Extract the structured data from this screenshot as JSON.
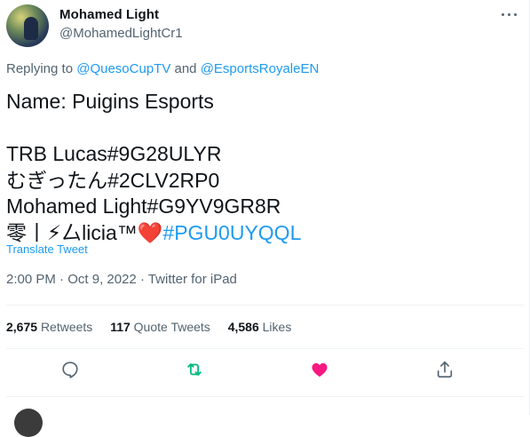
{
  "author": {
    "display_name": "Mohamed Light",
    "handle": "@MohamedLightCr1"
  },
  "reply": {
    "prefix": "Replying to ",
    "mention1": "@QuesoCupTV",
    "joiner": " and ",
    "mention2": "@EsportsRoyaleEN"
  },
  "tweet": {
    "line1": "Name: Puigins Esports",
    "line2": "TRB Lucas#9G28ULYR",
    "line3": "むぎったん#2CLV2RP0",
    "line4": "Mohamed Light#G9YV9GR8R",
    "line5_prefix": "零丨⚡厶licia™",
    "line5_heart": "❤️",
    "line5_hashtag": "#PGU0UYQQL",
    "translate_label": "Translate Tweet"
  },
  "meta": {
    "time": "2:00 PM",
    "sep1": " · ",
    "date": "Oct 9, 2022",
    "sep2": " · ",
    "source": "Twitter for iPad"
  },
  "stats": {
    "retweets_count": "2,675",
    "retweets_label": "Retweets",
    "quotes_count": "117",
    "quotes_label": "Quote Tweets",
    "likes_count": "4,586",
    "likes_label": "Likes"
  },
  "colors": {
    "accent": "#1d9bf0",
    "retweet_active": "#00ba7c",
    "like_active": "#f91880",
    "secondary_text": "#536471"
  },
  "icons": [
    "more-icon",
    "reply-icon",
    "retweet-icon",
    "like-icon",
    "share-icon"
  ]
}
